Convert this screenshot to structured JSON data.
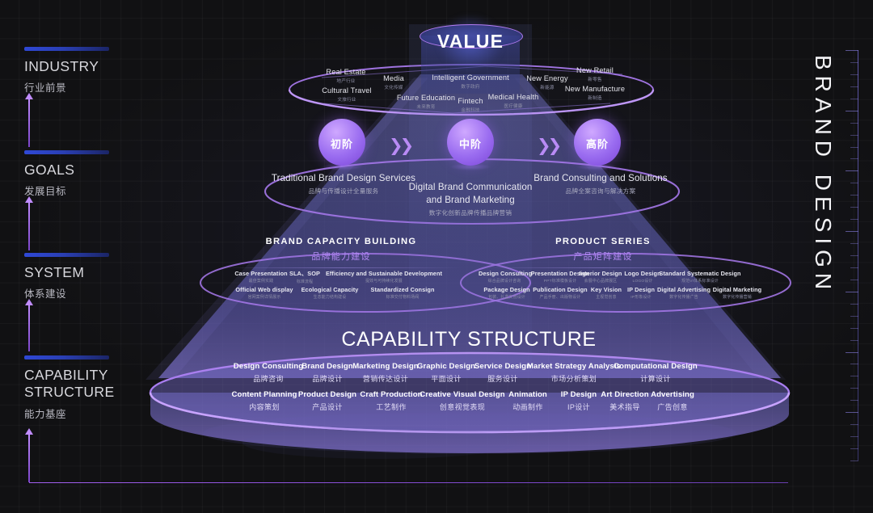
{
  "page": {
    "side_title": "BRAND  DESIGN",
    "value_label": "VALUE",
    "capability_title": "CAPABILITY STRUCTURE"
  },
  "stages": [
    {
      "en": "INDUSTRY",
      "cn": "行业前景"
    },
    {
      "en": "GOALS",
      "cn": "发展目标"
    },
    {
      "en": "SYSTEM",
      "cn": "体系建设"
    },
    {
      "en": "CAPABILITY STRUCTURE",
      "cn": "能力基座"
    }
  ],
  "industry": {
    "items": [
      {
        "en": "Real Estate",
        "cn": "地产行业"
      },
      {
        "en": "Cultural Travel",
        "cn": "文旅行业"
      },
      {
        "en": "Media",
        "cn": "文化传媒"
      },
      {
        "en": "Future Education",
        "cn": "未来教育"
      },
      {
        "en": "Intelligent Government",
        "cn": "数字政府"
      },
      {
        "en": "Fintech",
        "cn": "金融科技"
      },
      {
        "en": "Medical Health",
        "cn": "医疗健康"
      },
      {
        "en": "New Energy",
        "cn": "新能源"
      },
      {
        "en": "New Retail",
        "cn": "新零售"
      },
      {
        "en": "New Manufacture",
        "cn": "新制造"
      }
    ]
  },
  "goals": {
    "orbs": [
      "初阶",
      "中阶",
      "高阶"
    ],
    "arrow": "❯❯",
    "captions": [
      {
        "en": "Traditional Brand Design Services",
        "cn": "品牌与传播设计全量服务"
      },
      {
        "en": "Digital Brand Communication\nand Brand  Marketing",
        "cn": "数字化创新品牌传播品牌营销"
      },
      {
        "en": "Brand Consulting and Solutions",
        "cn": "品牌全案咨询与解决方案"
      }
    ]
  },
  "system": {
    "left": {
      "title_en": "BRAND CAPACITY BUILDING",
      "title_cn": "品牌能力建设",
      "row1": [
        {
          "en": "Case Presentation",
          "cn": "最佳案例实践"
        },
        {
          "en": "SLA、SOP",
          "cn": "标准流程"
        },
        {
          "en": "Efficiency and Sustainable Development",
          "cn": "提效与可持续化发展"
        }
      ],
      "row2": [
        {
          "en": "Official Web display",
          "cn": "官网案例详情展示"
        },
        {
          "en": "Ecological Capacity",
          "cn": "生态能力结构建设"
        },
        {
          "en": "Standardized Consign",
          "cn": "标准交付物料场阀"
        }
      ]
    },
    "right": {
      "title_en": "PRODUCT SERIES",
      "title_cn": "产品矩阵建设",
      "row1": [
        {
          "en": "Design Consulting",
          "cn": "综合品牌设计咨询"
        },
        {
          "en": "Presentation Design",
          "cn": "PPT标准模板设计"
        },
        {
          "en": "Interior Design",
          "cn": "会展中心品牌展区"
        },
        {
          "en": "Logo Design",
          "cn": "LOGO设计"
        },
        {
          "en": "Standard Systematic Design",
          "cn": "规范VI体系标准设计"
        }
      ],
      "row2": [
        {
          "en": "Package Design",
          "cn": "包装、礼盒文创设计"
        },
        {
          "en": "Publication Design",
          "cn": "产品手册、出版物设计"
        },
        {
          "en": "Key Vision",
          "cn": "主视觉创意"
        },
        {
          "en": "IP Design",
          "cn": "IP形象设计"
        },
        {
          "en": "Digital Advertising",
          "cn": "数字化传播广告"
        },
        {
          "en": "Digital Marketing",
          "cn": "数字化传播营销"
        }
      ]
    }
  },
  "capability": {
    "row1": [
      {
        "en": "Design Consulting",
        "cn": "品牌咨询"
      },
      {
        "en": "Brand Design",
        "cn": "品牌设计"
      },
      {
        "en": "Marketing Design",
        "cn": "营销传达设计"
      },
      {
        "en": "Graphic Design",
        "cn": "平面设计"
      },
      {
        "en": "Service Design",
        "cn": "服务设计"
      },
      {
        "en": "Market Strategy Analysis",
        "cn": "市场分析策划"
      },
      {
        "en": "Computational Design",
        "cn": "计算设计"
      }
    ],
    "row2": [
      {
        "en": "Content Planning",
        "cn": "内容策划"
      },
      {
        "en": "Product  Design",
        "cn": "产品设计"
      },
      {
        "en": "Craft Production",
        "cn": "工艺制作"
      },
      {
        "en": "Creative Visual Design",
        "cn": "创意视觉表现"
      },
      {
        "en": "Animation",
        "cn": "动画制作"
      },
      {
        "en": "IP Design",
        "cn": "IP设计"
      },
      {
        "en": "Art Direction",
        "cn": "美术指导"
      },
      {
        "en": "Advertising",
        "cn": "广告创意"
      }
    ]
  },
  "colors": {
    "accent_purple": "#b37cf2",
    "bar_blue": "#2f48d6",
    "background": "#111113"
  }
}
